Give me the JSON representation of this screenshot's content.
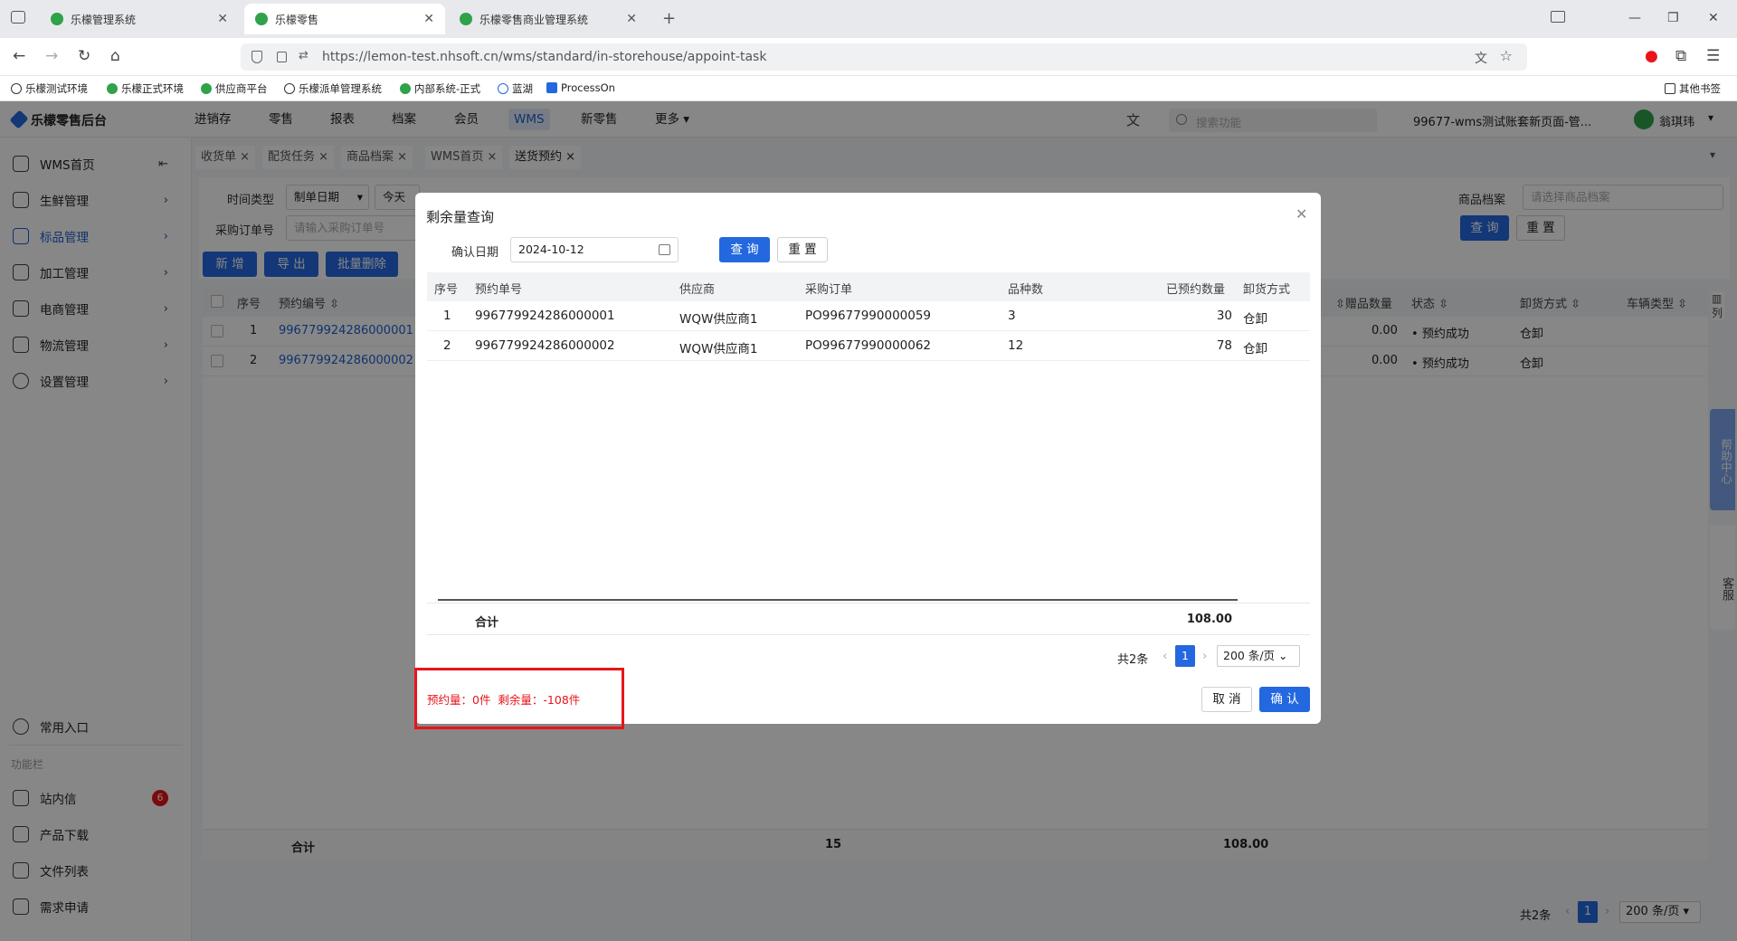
{
  "browser": {
    "tabs": [
      {
        "title": "乐檬管理系统"
      },
      {
        "title": "乐檬零售"
      },
      {
        "title": "乐檬零售商业管理系统"
      }
    ],
    "url": "https://lemon-test.nhsoft.cn/wms/standard/in-storehouse/appoint-task",
    "bookmarks": [
      "乐檬测试环境",
      "乐檬正式环境",
      "供应商平台",
      "乐檬派单管理系统",
      "内部系统-正式",
      "蓝湖",
      "ProcessOn"
    ],
    "other_bookmarks": "其他书签"
  },
  "app": {
    "logo": "乐檬零售后台",
    "topnav": [
      "进销存",
      "零售",
      "报表",
      "档案",
      "会员",
      "WMS",
      "新零售",
      "更多"
    ],
    "active_nav": "WMS",
    "search_placeholder": "搜索功能",
    "account": "99677-wms测试账套新页面-管...",
    "user": "翁琪玮"
  },
  "sidebar": {
    "items": [
      {
        "label": "WMS首页"
      },
      {
        "label": "生鲜管理"
      },
      {
        "label": "标品管理"
      },
      {
        "label": "加工管理"
      },
      {
        "label": "电商管理"
      },
      {
        "label": "物流管理"
      },
      {
        "label": "设置管理"
      }
    ],
    "bottom": {
      "common": "常用入口",
      "section": "功能栏",
      "items": [
        {
          "label": "站内信",
          "badge": "6"
        },
        {
          "label": "产品下载"
        },
        {
          "label": "文件列表"
        },
        {
          "label": "需求申请"
        }
      ]
    }
  },
  "page_tabs": [
    "收货单",
    "配货任务",
    "商品档案",
    "WMS首页",
    "送货预约"
  ],
  "filters": {
    "time_type_label": "时间类型",
    "time_type_value": "制单日期",
    "today": "今天",
    "po_label": "采购订单号",
    "po_placeholder": "请输入采购订单号",
    "goods_label": "商品档案",
    "goods_placeholder": "请选择商品档案",
    "query": "查 询",
    "reset": "重 置"
  },
  "toolbar": {
    "add": "新 增",
    "export": "导 出",
    "batch_delete": "批量删除"
  },
  "table": {
    "headers": {
      "no": "序号",
      "appoint_no": "预约编号",
      "gift_qty": "赠品数量",
      "status": "状态",
      "unload": "卸货方式",
      "vehicle": "车辆类型",
      "columns": "列"
    },
    "rows": [
      {
        "no": "1",
        "appoint_no": "996779924286000001",
        "gift_qty": "0.00",
        "status": "预约成功",
        "unload": "仓卸"
      },
      {
        "no": "2",
        "appoint_no": "996779924286000002",
        "gift_qty": "0.00",
        "status": "预约成功",
        "unload": "仓卸"
      }
    ],
    "footer": {
      "label": "合计",
      "count": "15",
      "amount": "108.00"
    },
    "pagination": {
      "total": "共2条",
      "page": "1",
      "size": "200 条/页"
    }
  },
  "float": {
    "help": "帮助中心",
    "service": "客服"
  },
  "dialog": {
    "title": "剩余量查询",
    "date_label": "确认日期",
    "date_value": "2024-10-12",
    "query": "查 询",
    "reset": "重 置",
    "headers": [
      "序号",
      "预约单号",
      "供应商",
      "采购订单",
      "品种数",
      "已预约数量",
      "卸货方式"
    ],
    "rows": [
      {
        "no": "1",
        "appoint_no": "996779924286000001",
        "supplier": "WQW供应商1",
        "po": "PO99677990000059",
        "kinds": "3",
        "qty": "30",
        "unload": "仓卸"
      },
      {
        "no": "2",
        "appoint_no": "996779924286000002",
        "supplier": "WQW供应商1",
        "po": "PO99677990000062",
        "kinds": "12",
        "qty": "78",
        "unload": "仓卸"
      }
    ],
    "footer": {
      "label": "合计",
      "total": "108.00"
    },
    "pagination": {
      "total": "共2条",
      "page": "1",
      "size": "200 条/页"
    },
    "summary": "预约量：0件  剩余量：-108件",
    "cancel": "取 消",
    "confirm": "确 认"
  },
  "colors": {
    "primary": "#2468e0",
    "alert": "#e8141a",
    "brand_green": "#2fa24a"
  }
}
